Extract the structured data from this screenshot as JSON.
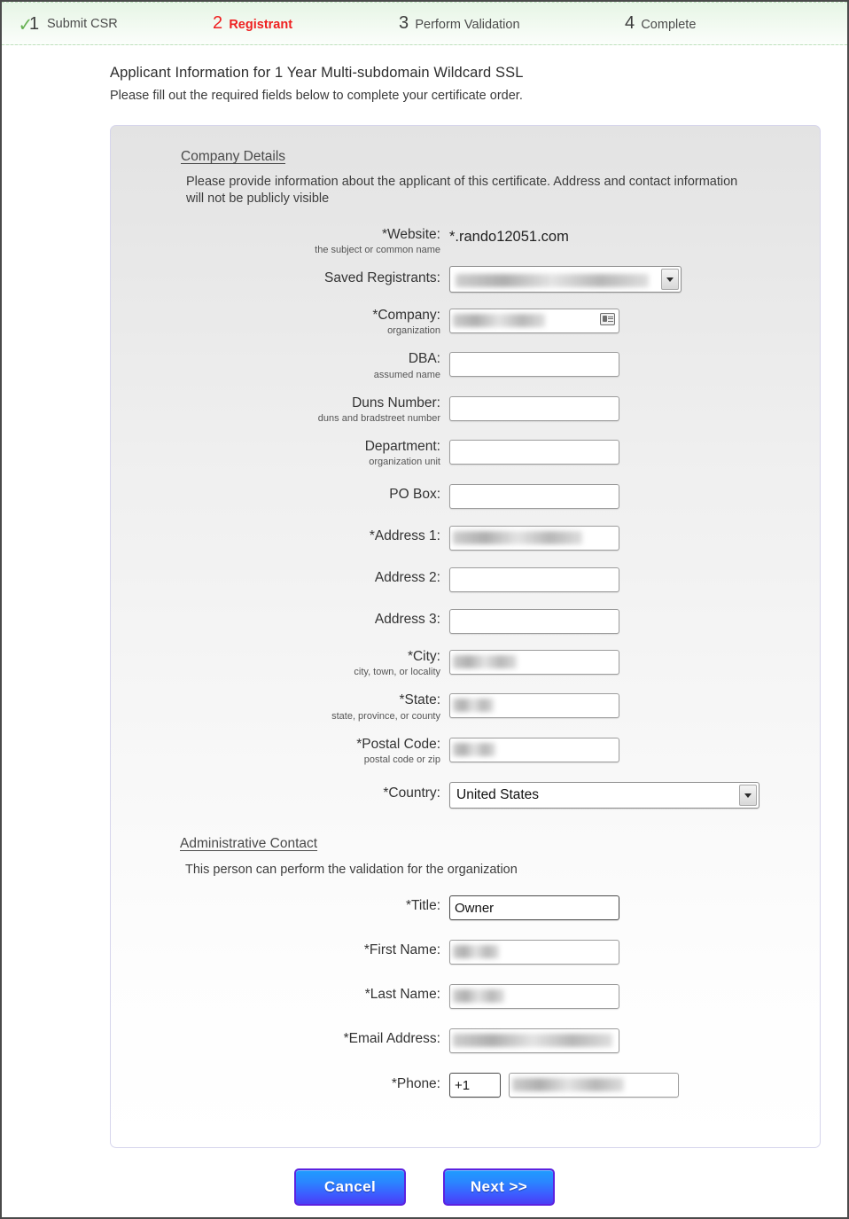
{
  "steps": [
    {
      "num": "1",
      "label": "Submit CSR",
      "state": "done",
      "icon": "check-icon"
    },
    {
      "num": "2",
      "label": "Registrant",
      "state": "active"
    },
    {
      "num": "3",
      "label": "Perform Validation",
      "state": "pending"
    },
    {
      "num": "4",
      "label": "Complete",
      "state": "pending"
    }
  ],
  "intro": {
    "title": "Applicant Information for 1 Year Multi-subdomain Wildcard SSL",
    "subtitle": "Please fill out the required fields below to complete your certificate order."
  },
  "company_section": {
    "heading": "Company Details",
    "description": "Please provide information about the applicant of this certificate. Address and contact information will not be publicly visible",
    "website": {
      "label": "*Website:",
      "sublabel": "the subject or common name",
      "value": "*.rando12051.com"
    },
    "saved_registrants": {
      "label": "Saved Registrants:",
      "value": "",
      "redacted": true
    },
    "company": {
      "label": "*Company:",
      "sublabel": "organization",
      "value": "",
      "redacted": true,
      "icon": "address-card-icon"
    },
    "dba": {
      "label": "DBA:",
      "sublabel": "assumed name",
      "value": ""
    },
    "duns": {
      "label": "Duns Number:",
      "sublabel": "duns and bradstreet number",
      "value": ""
    },
    "department": {
      "label": "Department:",
      "sublabel": "organization unit",
      "value": ""
    },
    "po_box": {
      "label": "PO Box:",
      "sublabel": "",
      "value": ""
    },
    "address1": {
      "label": "*Address 1:",
      "sublabel": "",
      "value": "",
      "redacted": true
    },
    "address2": {
      "label": "Address 2:",
      "sublabel": "",
      "value": ""
    },
    "address3": {
      "label": "Address 3:",
      "sublabel": "",
      "value": ""
    },
    "city": {
      "label": "*City:",
      "sublabel": "city, town, or locality",
      "value": "",
      "redacted": true
    },
    "state": {
      "label": "*State:",
      "sublabel": "state, province, or county",
      "value": "",
      "redacted": true
    },
    "postal": {
      "label": "*Postal Code:",
      "sublabel": "postal code or zip",
      "value": "",
      "redacted": true
    },
    "country": {
      "label": "*Country:",
      "sublabel": "",
      "value": "United States"
    }
  },
  "admin_section": {
    "heading": "Administrative Contact",
    "description": "This person can perform the validation for the organization",
    "title": {
      "label": "*Title:",
      "value": "Owner"
    },
    "first_name": {
      "label": "*First Name:",
      "value": "",
      "redacted": true
    },
    "last_name": {
      "label": "*Last Name:",
      "value": "",
      "redacted": true
    },
    "email": {
      "label": "*Email Address:",
      "value": "",
      "redacted": true
    },
    "phone": {
      "label": "*Phone:",
      "country_code": "+1",
      "number": "",
      "redacted": true
    }
  },
  "footer": {
    "cancel_label": "Cancel",
    "next_label": "Next >>"
  },
  "colors": {
    "active_step": "#ef2020",
    "check": "#67b153",
    "button_border": "#5b22e0",
    "stepbar_bg": "#e6f5e5"
  }
}
